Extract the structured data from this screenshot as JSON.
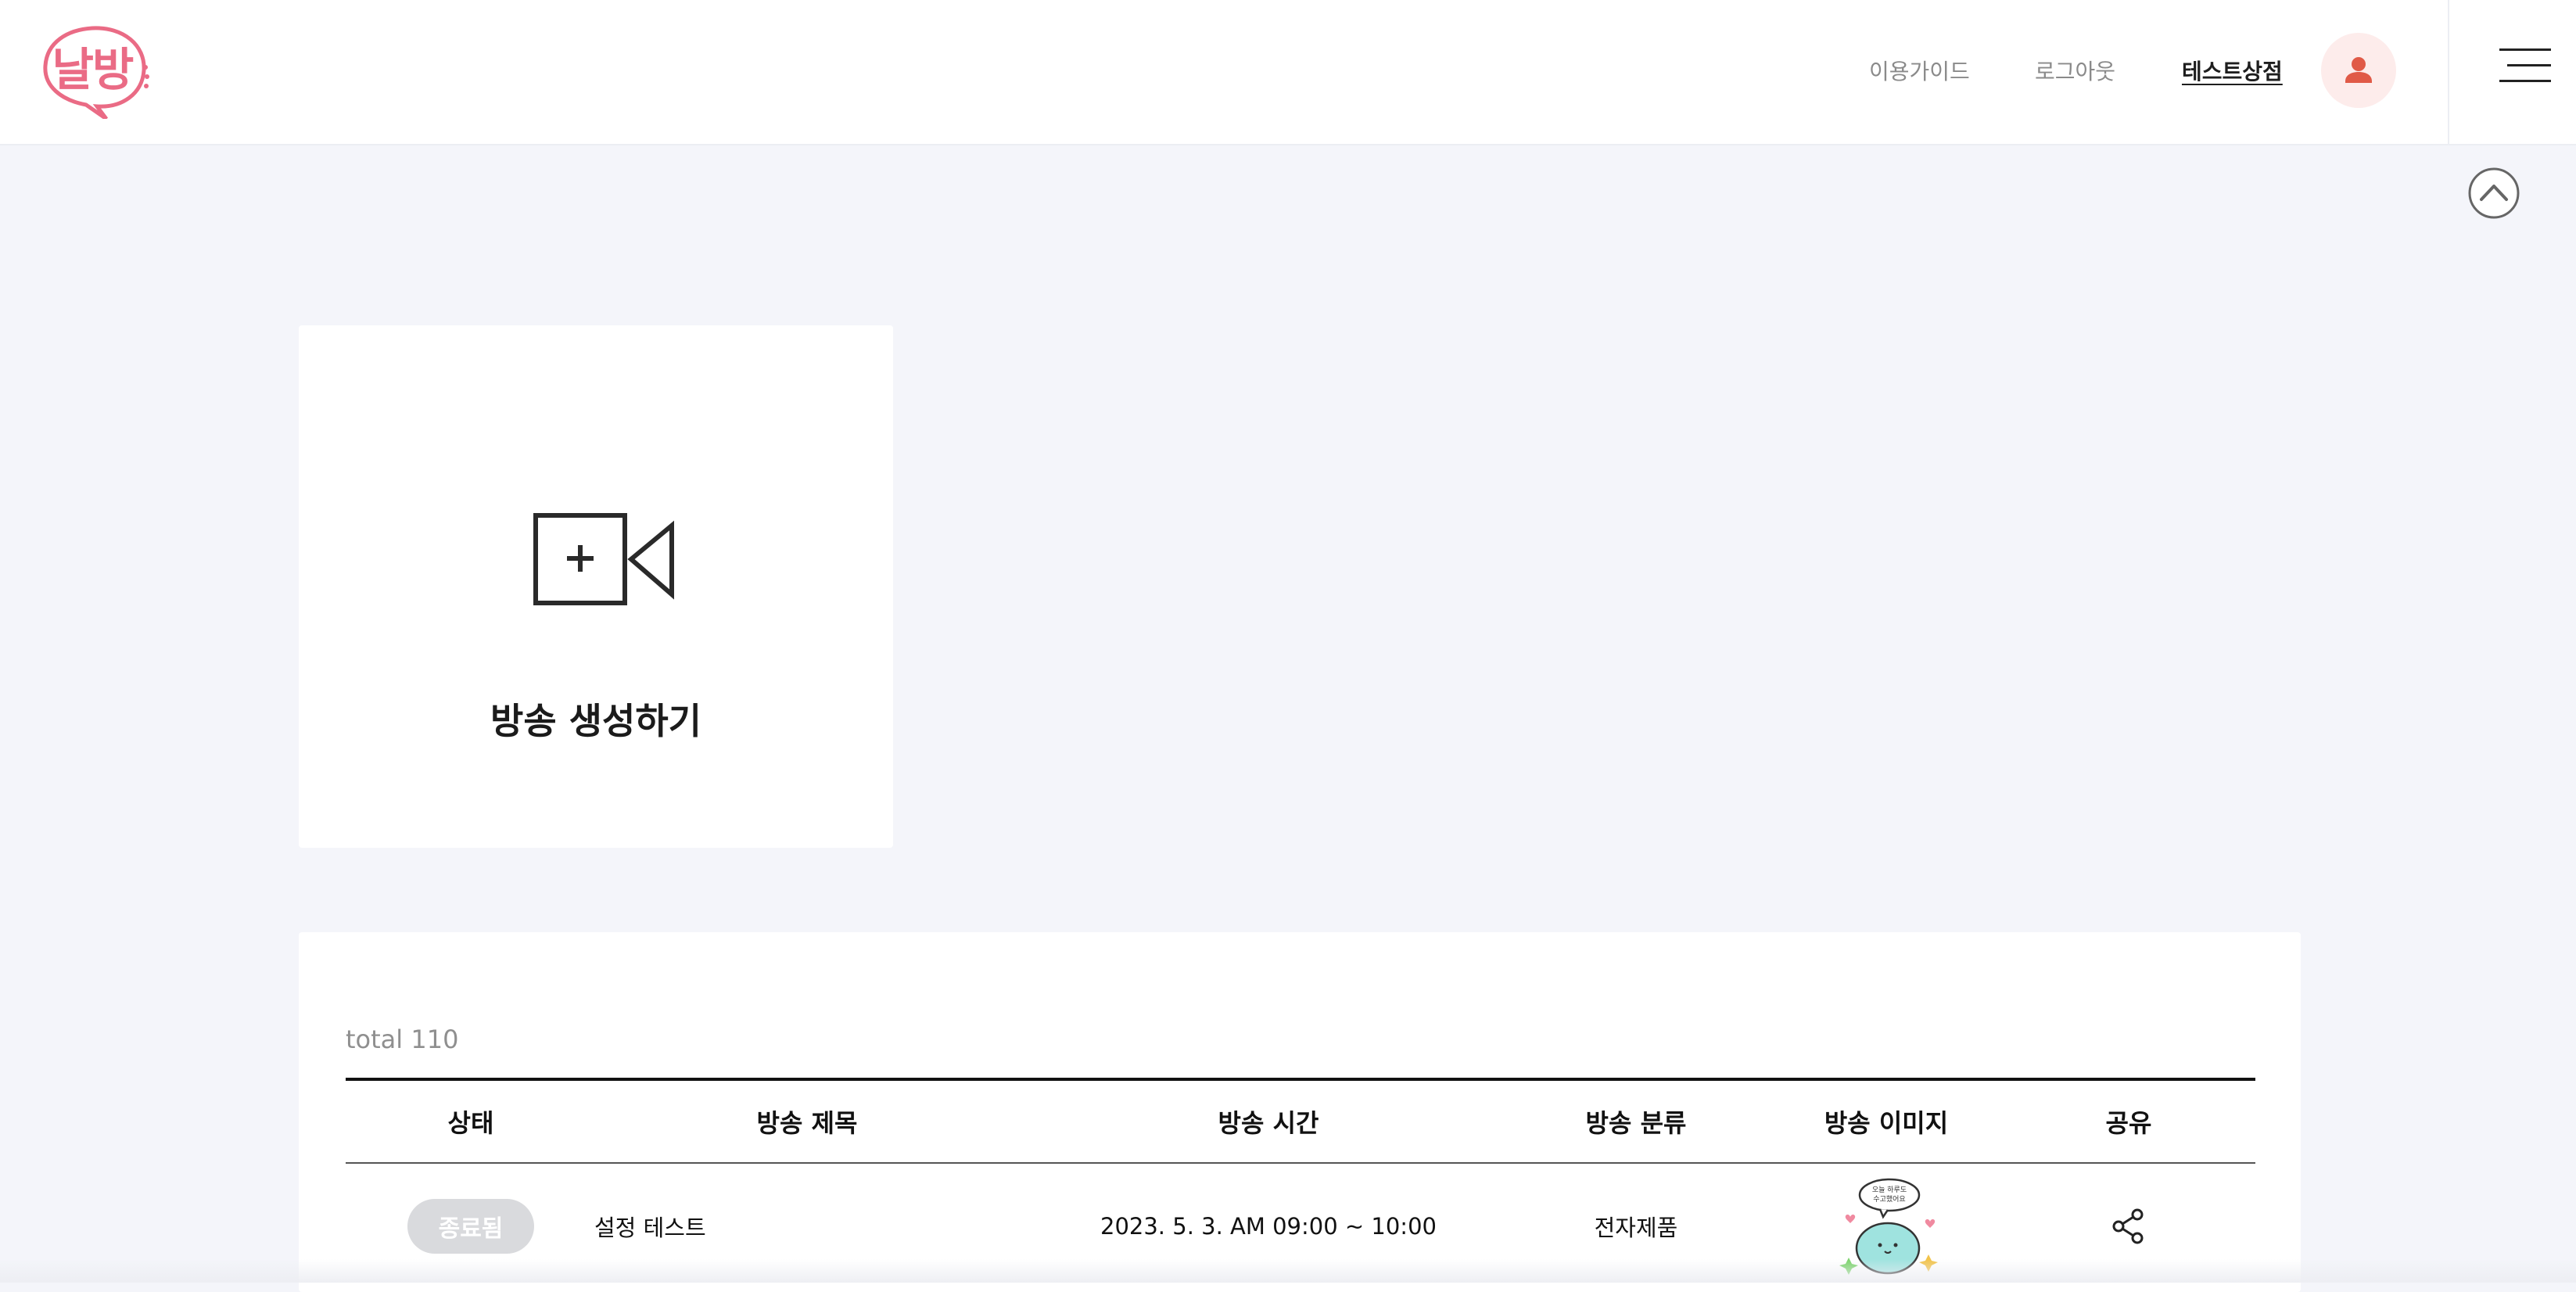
{
  "header": {
    "logo_text": "날방",
    "nav": [
      "이용가이드",
      "로그아웃",
      "테스트상점"
    ]
  },
  "colors": {
    "accent": "#ea6b85",
    "avatar_bg": "#fdeceb",
    "avatar_icon": "#e05a47",
    "page_bg": "#f4f5fa",
    "status_badge_bg": "#d9dadd"
  },
  "icons": {
    "avatar": "person-icon",
    "menu": "hamburger-icon",
    "scroll_top": "chevron-up-circle-icon",
    "create": "video-camera-plus-icon",
    "share": "share-icon"
  },
  "create_card": {
    "title": "방송 생성하기"
  },
  "list": {
    "total_label": "total 110",
    "columns": [
      "상태",
      "방송 제목",
      "방송 시간",
      "방송 분류",
      "방송 이미지",
      "공유"
    ],
    "rows": [
      {
        "status": "종료됨",
        "title": "설정 테스트",
        "time": "2023. 5. 3. AM 09:00 ~ 10:00",
        "category": "전자제품",
        "image_caption": "오늘 하루도 수고했어요"
      }
    ]
  }
}
